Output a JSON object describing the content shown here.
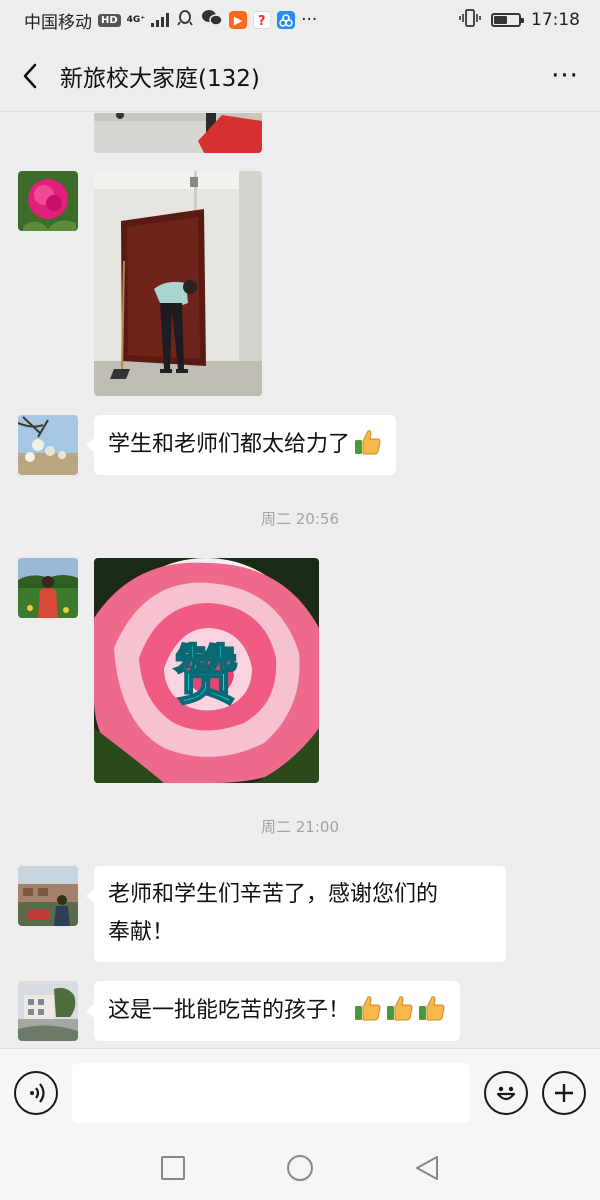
{
  "status_bar": {
    "carrier": "中国移动",
    "hd_badge": "HD",
    "network_type": "4G⁺",
    "time": "17:18",
    "battery_level": 0.55,
    "icons": [
      "signal-icon",
      "qq-icon",
      "wechat-icon",
      "video-app-icon",
      "app-icon",
      "network-app-icon",
      "more-notifications-icon",
      "vibrate-icon",
      "battery-icon"
    ],
    "more_dots": "···"
  },
  "header": {
    "title": "新旅校大家庭(132)",
    "more_label": "···"
  },
  "messages": [
    {
      "type": "image",
      "description_icon": "partial-photo"
    },
    {
      "type": "image",
      "description_icon": "door-photo"
    },
    {
      "type": "text",
      "text": "学生和老师们都太给力了",
      "emoji_count": 1
    },
    {
      "type": "timestamp",
      "text": "周二 20:56"
    },
    {
      "type": "image",
      "overlay_text": "赞"
    },
    {
      "type": "timestamp",
      "text": "周二 21:00"
    },
    {
      "type": "text",
      "lines": [
        "老师和学生们辛苦了，感谢您们的",
        "奉献！"
      ]
    },
    {
      "type": "text",
      "text": "这是一批能吃苦的孩子！",
      "emoji_count": 3
    }
  ],
  "input_bar": {
    "value": "",
    "placeholder": ""
  },
  "colors": {
    "background": "#ededed",
    "bubble": "#ffffff",
    "timestamp": "#a3a3a3",
    "zan_text": "#19e8f0",
    "rose": "#f0708f"
  }
}
